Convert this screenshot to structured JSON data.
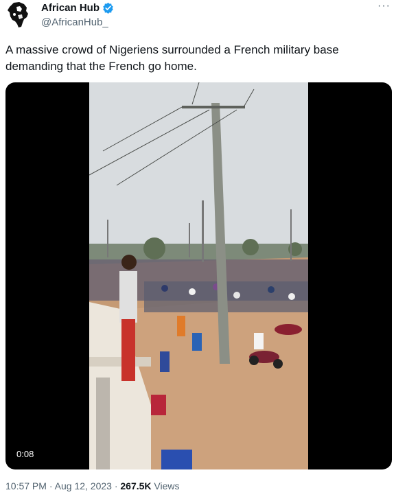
{
  "author": {
    "display_name": "African Hub",
    "handle": "@AfricanHub_",
    "verified": true
  },
  "tweet": {
    "text": "A massive crowd of Nigeriens surrounded a French military base demanding that the French go home."
  },
  "media": {
    "duration": "0:08"
  },
  "meta": {
    "time": "10:57 PM",
    "separator": "·",
    "date": "Aug 12, 2023",
    "views_count": "267.5K",
    "views_label": "Views"
  },
  "icons": {
    "verified": "verified-badge-icon",
    "more": "more-options-icon"
  },
  "colors": {
    "verified_blue": "#1d9bf0",
    "secondary_text": "#536471",
    "primary_text": "#0f1419"
  }
}
